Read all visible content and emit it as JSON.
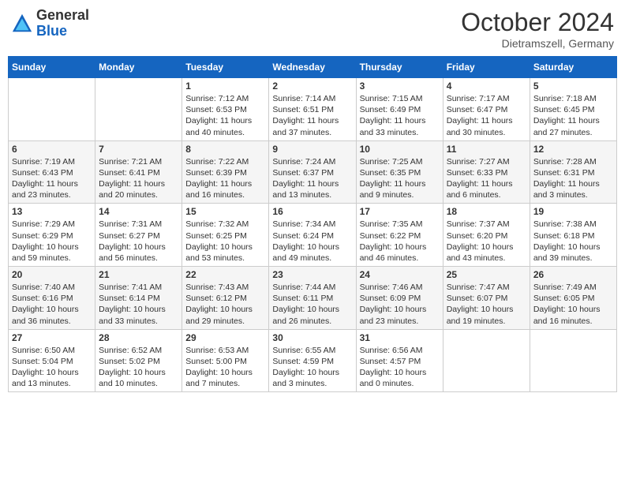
{
  "header": {
    "logo_general": "General",
    "logo_blue": "Blue",
    "month_title": "October 2024",
    "location": "Dietramszell, Germany"
  },
  "days_of_week": [
    "Sunday",
    "Monday",
    "Tuesday",
    "Wednesday",
    "Thursday",
    "Friday",
    "Saturday"
  ],
  "weeks": [
    [
      {
        "day": "",
        "info": ""
      },
      {
        "day": "",
        "info": ""
      },
      {
        "day": "1",
        "info": "Sunrise: 7:12 AM\nSunset: 6:53 PM\nDaylight: 11 hours and 40 minutes."
      },
      {
        "day": "2",
        "info": "Sunrise: 7:14 AM\nSunset: 6:51 PM\nDaylight: 11 hours and 37 minutes."
      },
      {
        "day": "3",
        "info": "Sunrise: 7:15 AM\nSunset: 6:49 PM\nDaylight: 11 hours and 33 minutes."
      },
      {
        "day": "4",
        "info": "Sunrise: 7:17 AM\nSunset: 6:47 PM\nDaylight: 11 hours and 30 minutes."
      },
      {
        "day": "5",
        "info": "Sunrise: 7:18 AM\nSunset: 6:45 PM\nDaylight: 11 hours and 27 minutes."
      }
    ],
    [
      {
        "day": "6",
        "info": "Sunrise: 7:19 AM\nSunset: 6:43 PM\nDaylight: 11 hours and 23 minutes."
      },
      {
        "day": "7",
        "info": "Sunrise: 7:21 AM\nSunset: 6:41 PM\nDaylight: 11 hours and 20 minutes."
      },
      {
        "day": "8",
        "info": "Sunrise: 7:22 AM\nSunset: 6:39 PM\nDaylight: 11 hours and 16 minutes."
      },
      {
        "day": "9",
        "info": "Sunrise: 7:24 AM\nSunset: 6:37 PM\nDaylight: 11 hours and 13 minutes."
      },
      {
        "day": "10",
        "info": "Sunrise: 7:25 AM\nSunset: 6:35 PM\nDaylight: 11 hours and 9 minutes."
      },
      {
        "day": "11",
        "info": "Sunrise: 7:27 AM\nSunset: 6:33 PM\nDaylight: 11 hours and 6 minutes."
      },
      {
        "day": "12",
        "info": "Sunrise: 7:28 AM\nSunset: 6:31 PM\nDaylight: 11 hours and 3 minutes."
      }
    ],
    [
      {
        "day": "13",
        "info": "Sunrise: 7:29 AM\nSunset: 6:29 PM\nDaylight: 10 hours and 59 minutes."
      },
      {
        "day": "14",
        "info": "Sunrise: 7:31 AM\nSunset: 6:27 PM\nDaylight: 10 hours and 56 minutes."
      },
      {
        "day": "15",
        "info": "Sunrise: 7:32 AM\nSunset: 6:25 PM\nDaylight: 10 hours and 53 minutes."
      },
      {
        "day": "16",
        "info": "Sunrise: 7:34 AM\nSunset: 6:24 PM\nDaylight: 10 hours and 49 minutes."
      },
      {
        "day": "17",
        "info": "Sunrise: 7:35 AM\nSunset: 6:22 PM\nDaylight: 10 hours and 46 minutes."
      },
      {
        "day": "18",
        "info": "Sunrise: 7:37 AM\nSunset: 6:20 PM\nDaylight: 10 hours and 43 minutes."
      },
      {
        "day": "19",
        "info": "Sunrise: 7:38 AM\nSunset: 6:18 PM\nDaylight: 10 hours and 39 minutes."
      }
    ],
    [
      {
        "day": "20",
        "info": "Sunrise: 7:40 AM\nSunset: 6:16 PM\nDaylight: 10 hours and 36 minutes."
      },
      {
        "day": "21",
        "info": "Sunrise: 7:41 AM\nSunset: 6:14 PM\nDaylight: 10 hours and 33 minutes."
      },
      {
        "day": "22",
        "info": "Sunrise: 7:43 AM\nSunset: 6:12 PM\nDaylight: 10 hours and 29 minutes."
      },
      {
        "day": "23",
        "info": "Sunrise: 7:44 AM\nSunset: 6:11 PM\nDaylight: 10 hours and 26 minutes."
      },
      {
        "day": "24",
        "info": "Sunrise: 7:46 AM\nSunset: 6:09 PM\nDaylight: 10 hours and 23 minutes."
      },
      {
        "day": "25",
        "info": "Sunrise: 7:47 AM\nSunset: 6:07 PM\nDaylight: 10 hours and 19 minutes."
      },
      {
        "day": "26",
        "info": "Sunrise: 7:49 AM\nSunset: 6:05 PM\nDaylight: 10 hours and 16 minutes."
      }
    ],
    [
      {
        "day": "27",
        "info": "Sunrise: 6:50 AM\nSunset: 5:04 PM\nDaylight: 10 hours and 13 minutes."
      },
      {
        "day": "28",
        "info": "Sunrise: 6:52 AM\nSunset: 5:02 PM\nDaylight: 10 hours and 10 minutes."
      },
      {
        "day": "29",
        "info": "Sunrise: 6:53 AM\nSunset: 5:00 PM\nDaylight: 10 hours and 7 minutes."
      },
      {
        "day": "30",
        "info": "Sunrise: 6:55 AM\nSunset: 4:59 PM\nDaylight: 10 hours and 3 minutes."
      },
      {
        "day": "31",
        "info": "Sunrise: 6:56 AM\nSunset: 4:57 PM\nDaylight: 10 hours and 0 minutes."
      },
      {
        "day": "",
        "info": ""
      },
      {
        "day": "",
        "info": ""
      }
    ]
  ]
}
